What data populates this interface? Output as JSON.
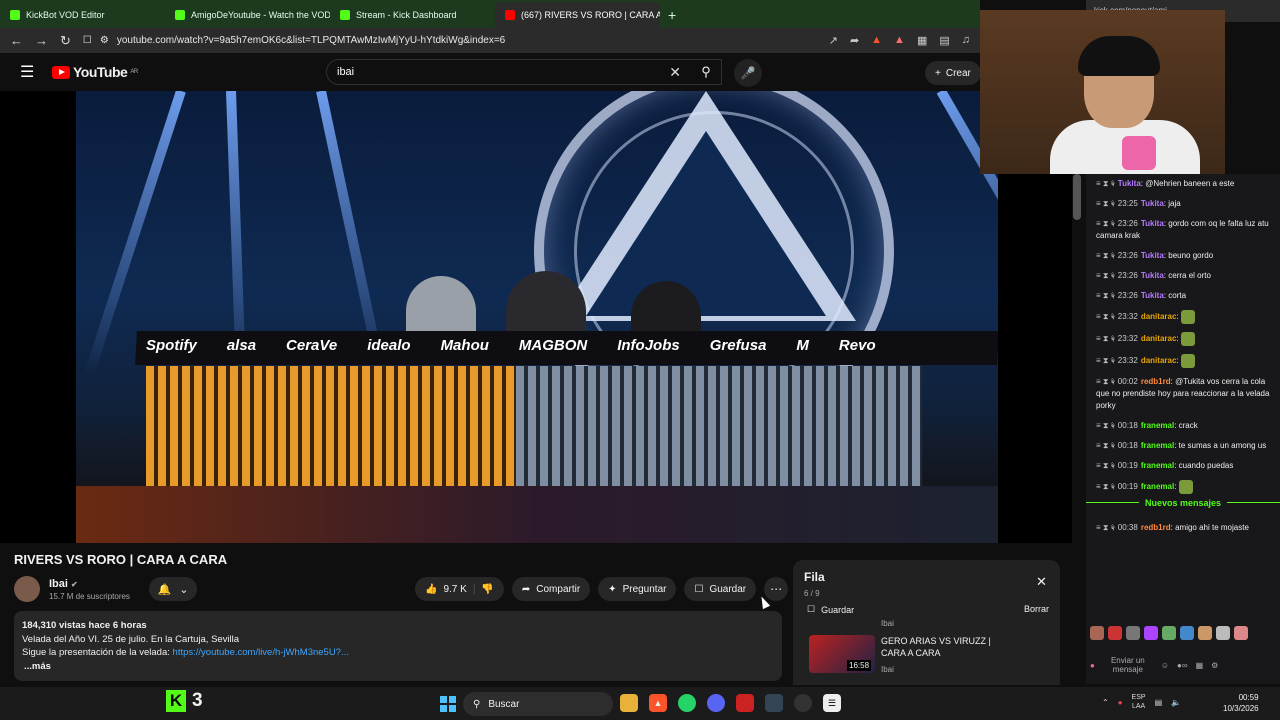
{
  "browser": {
    "tabs": [
      {
        "label": "KickBot VOD Editor",
        "color": "#53fc18",
        "active": false
      },
      {
        "label": "AmigoDeYoutube - Watch the VOD ...",
        "color": "#53fc18",
        "active": false
      },
      {
        "label": "Stream - Kick Dashboard",
        "color": "#53fc18",
        "active": false
      },
      {
        "label": "(667) RIVERS VS RORO | CARA A...",
        "color": "#ff0000",
        "active": true
      }
    ],
    "url": "youtube.com/watch?v=9a5h7emOK6c&list=TLPQMTAwMzIwMjYyU-hYtdkiWg&index=6",
    "right_tab": "kick.com/popout/ami..."
  },
  "youtube": {
    "logo_text": "YouTube",
    "region": "AR",
    "search_value": "ibai",
    "create_label": "Crear"
  },
  "video": {
    "sponsors": [
      "Spotify",
      "alsa",
      "CeraVe",
      "idealo",
      "Mahou",
      "MAGBON",
      "InfoJobs",
      "Grefusa",
      "M",
      "Revo"
    ],
    "title": "RIVERS VS RORO | CARA A CARA",
    "channel": "Ibai",
    "subscribers": "15.7 M de suscriptores",
    "likes": "9.7 K",
    "share_label": "Compartir",
    "ask_label": "Preguntar",
    "save_label": "Guardar",
    "desc_meta": "184,310 vistas  hace 6 horas",
    "desc_line1": "Velada del Año VI. 25 de julio. En la Cartuja, Sevilla",
    "desc_line2_prefix": "Sigue la presentación de la velada: ",
    "desc_link": "https://youtube.com/live/h-jWhM3ne5U?...",
    "desc_more": "...más"
  },
  "queue": {
    "title": "Fila",
    "count": "6 / 9",
    "save_label": "Guardar",
    "clear_label": "Borrar",
    "item": {
      "title": "GERO ARIAS VS VIRUZZ | CARA A CARA",
      "channel": "Ibai",
      "duration": "16:58",
      "prev_channel": "Ibai"
    }
  },
  "chat": {
    "messages": [
      {
        "time": "",
        "user": "Tukita",
        "text": "@Nehrien baneen a este",
        "color": "#b47aff",
        "emote": false
      },
      {
        "time": "23:25",
        "user": "Tukita",
        "text": "jaja",
        "color": "#b47aff",
        "emote": false
      },
      {
        "time": "23:26",
        "user": "Tukita",
        "text": "gordo com oq le falta luz atu camara krak",
        "color": "#b47aff",
        "emote": false
      },
      {
        "time": "23:26",
        "user": "Tukita",
        "text": "beuno gordo",
        "color": "#b47aff",
        "emote": false
      },
      {
        "time": "23:26",
        "user": "Tukita",
        "text": "cerra el orto",
        "color": "#b47aff",
        "emote": false
      },
      {
        "time": "23:26",
        "user": "Tukita",
        "text": "corta",
        "color": "#b47aff",
        "emote": false
      },
      {
        "time": "23:32",
        "user": "danitarac",
        "text": "",
        "color": "#e8a400",
        "emote": true
      },
      {
        "time": "23:32",
        "user": "danitarac",
        "text": "",
        "color": "#e8a400",
        "emote": true
      },
      {
        "time": "23:32",
        "user": "danitarac",
        "text": "",
        "color": "#e8a400",
        "emote": true
      },
      {
        "time": "00:02",
        "user": "redb1rd",
        "text": "@Tukita vos cerra la cola que no prendiste hoy para reaccionar a la velada porky",
        "color": "#ff8a3d",
        "emote": false
      },
      {
        "time": "00:18",
        "user": "franemal",
        "text": "crack",
        "color": "#53fc18",
        "emote": false
      },
      {
        "time": "00:18",
        "user": "franemal",
        "text": "te sumas a un among us",
        "color": "#53fc18",
        "emote": false
      },
      {
        "time": "00:19",
        "user": "franemal",
        "text": "cuando puedas",
        "color": "#53fc18",
        "emote": false
      },
      {
        "time": "00:19",
        "user": "franemal",
        "text": "",
        "color": "#53fc18",
        "emote": true
      }
    ],
    "new_messages_label": "Nuevos mensajes",
    "after_new": {
      "time": "00:38",
      "user": "redb1rd",
      "text": "amigo ahi te mojaste",
      "color": "#ff8a3d"
    },
    "send_placeholder": "Enviar un mensaje"
  },
  "taskbar": {
    "kick_count": "3",
    "search_label": "Buscar",
    "language": "ESP",
    "language_sub": "LAA",
    "time": "00:59",
    "date": "10/3/2026"
  }
}
